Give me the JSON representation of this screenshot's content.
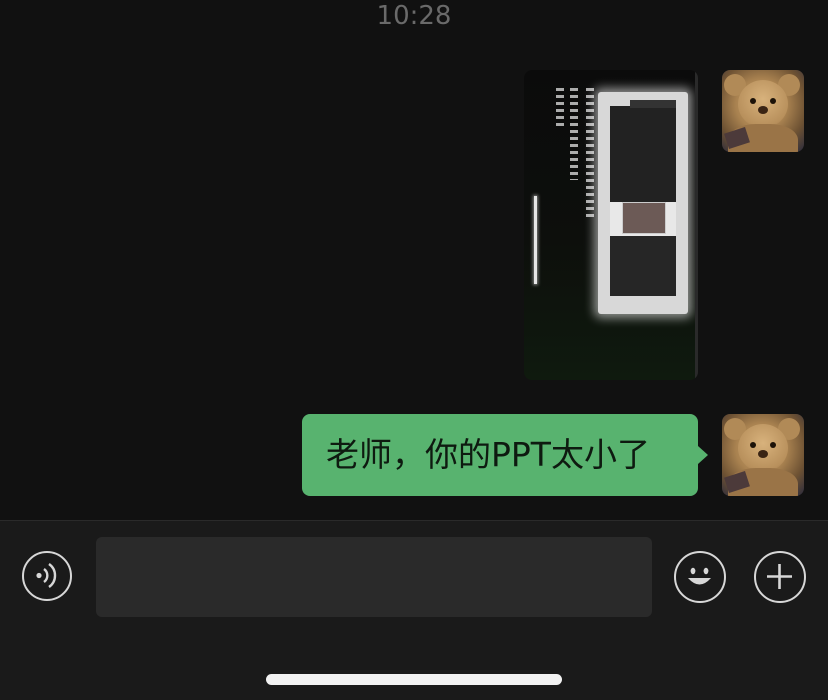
{
  "header": {
    "timestamp": "10:28"
  },
  "messages": [
    {
      "type": "image",
      "sender": "self",
      "image_icon": "photo-of-monitor-screen"
    },
    {
      "type": "text",
      "sender": "self",
      "text": "老师，你的PPT太小了"
    }
  ],
  "avatar": {
    "icon": "teddy-bear-avatar"
  },
  "input_bar": {
    "voice_icon": "voice-icon",
    "input_value": "",
    "emoji_icon": "emoji-icon",
    "plus_icon": "plus-icon"
  },
  "colors": {
    "background": "#111111",
    "bubble": "#58b36f",
    "input_bar": "#1a1a1a",
    "input_field": "#2a2a2a"
  }
}
